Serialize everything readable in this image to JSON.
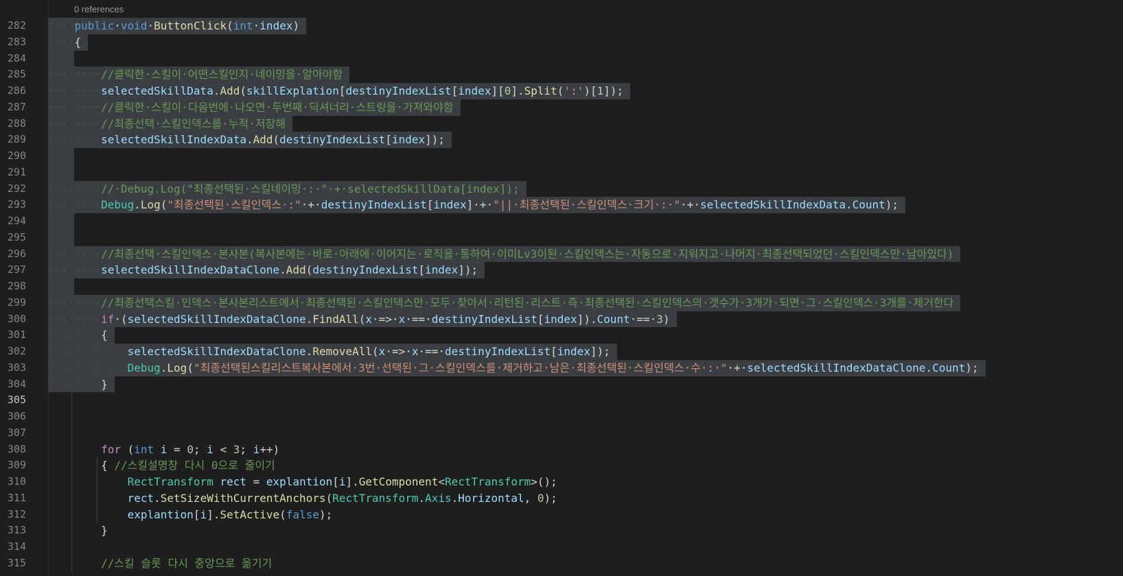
{
  "editor": {
    "codelens": "0 references",
    "current_line": "305",
    "colors": {
      "background": "#1e1e1e",
      "selection": "#3a3d41",
      "keyword": "#569cd6",
      "function": "#dcdcaa",
      "type": "#4ec9b0",
      "variable": "#9cdcfe",
      "string": "#ce9178",
      "number": "#b5cea8",
      "comment": "#6a9955"
    },
    "lines": [
      {
        "n": "282",
        "sel": true,
        "indent": 1,
        "tokens": [
          {
            "t": "public",
            "c": "kw"
          },
          {
            "t": " ",
            "c": "pl"
          },
          {
            "t": "void",
            "c": "kw"
          },
          {
            "t": " ",
            "c": "pl"
          },
          {
            "t": "ButtonClick",
            "c": "fn"
          },
          {
            "t": "(",
            "c": "pl"
          },
          {
            "t": "int",
            "c": "kw"
          },
          {
            "t": " ",
            "c": "pl"
          },
          {
            "t": "index",
            "c": "var"
          },
          {
            "t": ")",
            "c": "pl"
          }
        ]
      },
      {
        "n": "283",
        "sel": true,
        "indent": 1,
        "tokens": [
          {
            "t": "{",
            "c": "pl"
          }
        ]
      },
      {
        "n": "284",
        "sel": true,
        "indent": 0,
        "tokens": []
      },
      {
        "n": "285",
        "sel": true,
        "indent": 2,
        "tokens": [
          {
            "t": "//클릭한 스킬이 어떤스킬인지 네이밍을 알아야함",
            "c": "cm"
          }
        ]
      },
      {
        "n": "286",
        "sel": true,
        "indent": 2,
        "tokens": [
          {
            "t": "selectedSkillData",
            "c": "var"
          },
          {
            "t": ".",
            "c": "pl"
          },
          {
            "t": "Add",
            "c": "fn"
          },
          {
            "t": "(",
            "c": "pl"
          },
          {
            "t": "skillExplation",
            "c": "var"
          },
          {
            "t": "[",
            "c": "pl"
          },
          {
            "t": "destinyIndexList",
            "c": "var"
          },
          {
            "t": "[",
            "c": "pl"
          },
          {
            "t": "index",
            "c": "var"
          },
          {
            "t": "][",
            "c": "pl"
          },
          {
            "t": "0",
            "c": "num"
          },
          {
            "t": "].",
            "c": "pl"
          },
          {
            "t": "Split",
            "c": "fn"
          },
          {
            "t": "(",
            "c": "pl"
          },
          {
            "t": "':'",
            "c": "str"
          },
          {
            "t": ")[",
            "c": "pl"
          },
          {
            "t": "1",
            "c": "num"
          },
          {
            "t": "]);",
            "c": "pl"
          }
        ]
      },
      {
        "n": "287",
        "sel": true,
        "indent": 2,
        "tokens": [
          {
            "t": "//클릭한 스킬이 다음번에 나오면 두번째 딕셔너리 스트링을 가져와야함",
            "c": "cm"
          }
        ]
      },
      {
        "n": "288",
        "sel": true,
        "indent": 2,
        "tokens": [
          {
            "t": "//최종선택 스킬인덱스를 누적 저장해",
            "c": "cm"
          }
        ]
      },
      {
        "n": "289",
        "sel": true,
        "indent": 2,
        "tokens": [
          {
            "t": "selectedSkillIndexData",
            "c": "var"
          },
          {
            "t": ".",
            "c": "pl"
          },
          {
            "t": "Add",
            "c": "fn"
          },
          {
            "t": "(",
            "c": "pl"
          },
          {
            "t": "destinyIndexList",
            "c": "var"
          },
          {
            "t": "[",
            "c": "pl"
          },
          {
            "t": "index",
            "c": "var"
          },
          {
            "t": "]);",
            "c": "pl"
          }
        ]
      },
      {
        "n": "290",
        "sel": true,
        "indent": 0,
        "tokens": []
      },
      {
        "n": "291",
        "sel": true,
        "indent": 0,
        "tokens": []
      },
      {
        "n": "292",
        "sel": true,
        "indent": 2,
        "tokens": [
          {
            "t": "// Debug.Log(\"최종선택된 스킬네이밍 : \" + selectedSkillData[index]);",
            "c": "cm"
          }
        ]
      },
      {
        "n": "293",
        "sel": true,
        "indent": 2,
        "tokens": [
          {
            "t": "Debug",
            "c": "ty"
          },
          {
            "t": ".",
            "c": "pl"
          },
          {
            "t": "Log",
            "c": "fn"
          },
          {
            "t": "(",
            "c": "pl"
          },
          {
            "t": "\"최종선택된 스킬인덱스 :\"",
            "c": "str"
          },
          {
            "t": " + ",
            "c": "pl"
          },
          {
            "t": "destinyIndexList",
            "c": "var"
          },
          {
            "t": "[",
            "c": "pl"
          },
          {
            "t": "index",
            "c": "var"
          },
          {
            "t": "] + ",
            "c": "pl"
          },
          {
            "t": "\"|| 최종선택된 스킬인덱스 크기 : \"",
            "c": "str"
          },
          {
            "t": " + ",
            "c": "pl"
          },
          {
            "t": "selectedSkillIndexData",
            "c": "var"
          },
          {
            "t": ".",
            "c": "pl"
          },
          {
            "t": "Count",
            "c": "var"
          },
          {
            "t": ");",
            "c": "pl"
          }
        ]
      },
      {
        "n": "294",
        "sel": true,
        "indent": 0,
        "tokens": []
      },
      {
        "n": "295",
        "sel": true,
        "indent": 0,
        "tokens": []
      },
      {
        "n": "296",
        "sel": true,
        "indent": 2,
        "tokens": [
          {
            "t": "//최종선택 스킬인덱스 본사본(복사본에는 바로 아래에 이어지는 로직을 통하여 이미Lv3이된 스킬인덱스는 자동으로 지워지고 나머지 최종선택되었던 스킬인덱스만 남아있다)",
            "c": "cm"
          }
        ]
      },
      {
        "n": "297",
        "sel": true,
        "indent": 2,
        "tokens": [
          {
            "t": "selectedSkillIndexDataClone",
            "c": "var"
          },
          {
            "t": ".",
            "c": "pl"
          },
          {
            "t": "Add",
            "c": "fn"
          },
          {
            "t": "(",
            "c": "pl"
          },
          {
            "t": "destinyIndexList",
            "c": "var"
          },
          {
            "t": "[",
            "c": "pl"
          },
          {
            "t": "index",
            "c": "var"
          },
          {
            "t": "]);",
            "c": "pl"
          }
        ]
      },
      {
        "n": "298",
        "sel": true,
        "indent": 0,
        "tokens": []
      },
      {
        "n": "299",
        "sel": true,
        "indent": 2,
        "tokens": [
          {
            "t": "//최종선택스킬 인덱스 본사본리스트에서 최종선택된 스킬인덱스만 모두 찾아서 리턴된 리스트 즉 최종선택된 스킬인덱스의 갯수가 3개가 되면 그 스킬인덱스 3개를 제거한다",
            "c": "cm"
          }
        ]
      },
      {
        "n": "300",
        "sel": true,
        "indent": 2,
        "tokens": [
          {
            "t": "if",
            "c": "ctl"
          },
          {
            "t": " (",
            "c": "pl"
          },
          {
            "t": "selectedSkillIndexDataClone",
            "c": "var"
          },
          {
            "t": ".",
            "c": "pl"
          },
          {
            "t": "FindAll",
            "c": "fn"
          },
          {
            "t": "(",
            "c": "pl"
          },
          {
            "t": "x",
            "c": "var"
          },
          {
            "t": " => ",
            "c": "pl"
          },
          {
            "t": "x",
            "c": "var"
          },
          {
            "t": " == ",
            "c": "pl"
          },
          {
            "t": "destinyIndexList",
            "c": "var"
          },
          {
            "t": "[",
            "c": "pl"
          },
          {
            "t": "index",
            "c": "var"
          },
          {
            "t": "]).",
            "c": "pl"
          },
          {
            "t": "Count",
            "c": "var"
          },
          {
            "t": " == ",
            "c": "pl"
          },
          {
            "t": "3",
            "c": "num"
          },
          {
            "t": ")",
            "c": "pl"
          }
        ]
      },
      {
        "n": "301",
        "sel": true,
        "indent": 2,
        "tokens": [
          {
            "t": "{",
            "c": "pl"
          }
        ]
      },
      {
        "n": "302",
        "sel": true,
        "indent": 3,
        "tokens": [
          {
            "t": "selectedSkillIndexDataClone",
            "c": "var"
          },
          {
            "t": ".",
            "c": "pl"
          },
          {
            "t": "RemoveAll",
            "c": "fn"
          },
          {
            "t": "(",
            "c": "pl"
          },
          {
            "t": "x",
            "c": "var"
          },
          {
            "t": " => ",
            "c": "pl"
          },
          {
            "t": "x",
            "c": "var"
          },
          {
            "t": " == ",
            "c": "pl"
          },
          {
            "t": "destinyIndexList",
            "c": "var"
          },
          {
            "t": "[",
            "c": "pl"
          },
          {
            "t": "index",
            "c": "var"
          },
          {
            "t": "]);",
            "c": "pl"
          }
        ]
      },
      {
        "n": "303",
        "sel": true,
        "indent": 3,
        "tokens": [
          {
            "t": "Debug",
            "c": "ty"
          },
          {
            "t": ".",
            "c": "pl"
          },
          {
            "t": "Log",
            "c": "fn"
          },
          {
            "t": "(",
            "c": "pl"
          },
          {
            "t": "\"최종선택된스킬리스트복사본에서 3번 선택된 그 스킬인덱스를 제거하고 남은 최종선택된 스킬인덱스 수 : \"",
            "c": "str"
          },
          {
            "t": " + ",
            "c": "pl"
          },
          {
            "t": "selectedSkillIndexDataClone",
            "c": "var"
          },
          {
            "t": ".",
            "c": "pl"
          },
          {
            "t": "Count",
            "c": "var"
          },
          {
            "t": ");",
            "c": "pl"
          }
        ]
      },
      {
        "n": "304",
        "sel": true,
        "indent": 2,
        "tokens": [
          {
            "t": "}",
            "c": "pl"
          }
        ]
      },
      {
        "n": "305",
        "sel": false,
        "indent": 0,
        "tokens": []
      },
      {
        "n": "306",
        "sel": false,
        "indent": 0,
        "tokens": []
      },
      {
        "n": "307",
        "sel": false,
        "indent": 0,
        "tokens": []
      },
      {
        "n": "308",
        "sel": false,
        "indent": 2,
        "tokens": [
          {
            "t": "for",
            "c": "ctl"
          },
          {
            "t": " (",
            "c": "pl"
          },
          {
            "t": "int",
            "c": "kw"
          },
          {
            "t": " ",
            "c": "pl"
          },
          {
            "t": "i",
            "c": "var"
          },
          {
            "t": " = ",
            "c": "pl"
          },
          {
            "t": "0",
            "c": "num"
          },
          {
            "t": "; ",
            "c": "pl"
          },
          {
            "t": "i",
            "c": "var"
          },
          {
            "t": " < ",
            "c": "pl"
          },
          {
            "t": "3",
            "c": "num"
          },
          {
            "t": "; ",
            "c": "pl"
          },
          {
            "t": "i",
            "c": "var"
          },
          {
            "t": "++)",
            "c": "pl"
          }
        ]
      },
      {
        "n": "309",
        "sel": false,
        "indent": 2,
        "tokens": [
          {
            "t": "{ ",
            "c": "pl"
          },
          {
            "t": "//스킬설명창 다시 0으로 줄이기",
            "c": "cm"
          }
        ]
      },
      {
        "n": "310",
        "sel": false,
        "indent": 3,
        "tokens": [
          {
            "t": "RectTransform",
            "c": "ty"
          },
          {
            "t": " ",
            "c": "pl"
          },
          {
            "t": "rect",
            "c": "var"
          },
          {
            "t": " = ",
            "c": "pl"
          },
          {
            "t": "explantion",
            "c": "var"
          },
          {
            "t": "[",
            "c": "pl"
          },
          {
            "t": "i",
            "c": "var"
          },
          {
            "t": "].",
            "c": "pl"
          },
          {
            "t": "GetComponent",
            "c": "fn"
          },
          {
            "t": "<",
            "c": "pl"
          },
          {
            "t": "RectTransform",
            "c": "ty"
          },
          {
            "t": ">();",
            "c": "pl"
          }
        ]
      },
      {
        "n": "311",
        "sel": false,
        "indent": 3,
        "tokens": [
          {
            "t": "rect",
            "c": "var"
          },
          {
            "t": ".",
            "c": "pl"
          },
          {
            "t": "SetSizeWithCurrentAnchors",
            "c": "fn"
          },
          {
            "t": "(",
            "c": "pl"
          },
          {
            "t": "RectTransform",
            "c": "ty"
          },
          {
            "t": ".",
            "c": "pl"
          },
          {
            "t": "Axis",
            "c": "ty"
          },
          {
            "t": ".",
            "c": "pl"
          },
          {
            "t": "Horizontal",
            "c": "var"
          },
          {
            "t": ", ",
            "c": "pl"
          },
          {
            "t": "0",
            "c": "num"
          },
          {
            "t": ");",
            "c": "pl"
          }
        ]
      },
      {
        "n": "312",
        "sel": false,
        "indent": 3,
        "tokens": [
          {
            "t": "explantion",
            "c": "var"
          },
          {
            "t": "[",
            "c": "pl"
          },
          {
            "t": "i",
            "c": "var"
          },
          {
            "t": "].",
            "c": "pl"
          },
          {
            "t": "SetActive",
            "c": "fn"
          },
          {
            "t": "(",
            "c": "pl"
          },
          {
            "t": "false",
            "c": "kw"
          },
          {
            "t": ");",
            "c": "pl"
          }
        ]
      },
      {
        "n": "313",
        "sel": false,
        "indent": 2,
        "tokens": [
          {
            "t": "}",
            "c": "pl"
          }
        ]
      },
      {
        "n": "314",
        "sel": false,
        "indent": 0,
        "tokens": []
      },
      {
        "n": "315",
        "sel": false,
        "indent": 2,
        "tokens": [
          {
            "t": "//스킬 슬롯 다시 중앙으로 옮기기",
            "c": "cm"
          }
        ]
      }
    ]
  }
}
